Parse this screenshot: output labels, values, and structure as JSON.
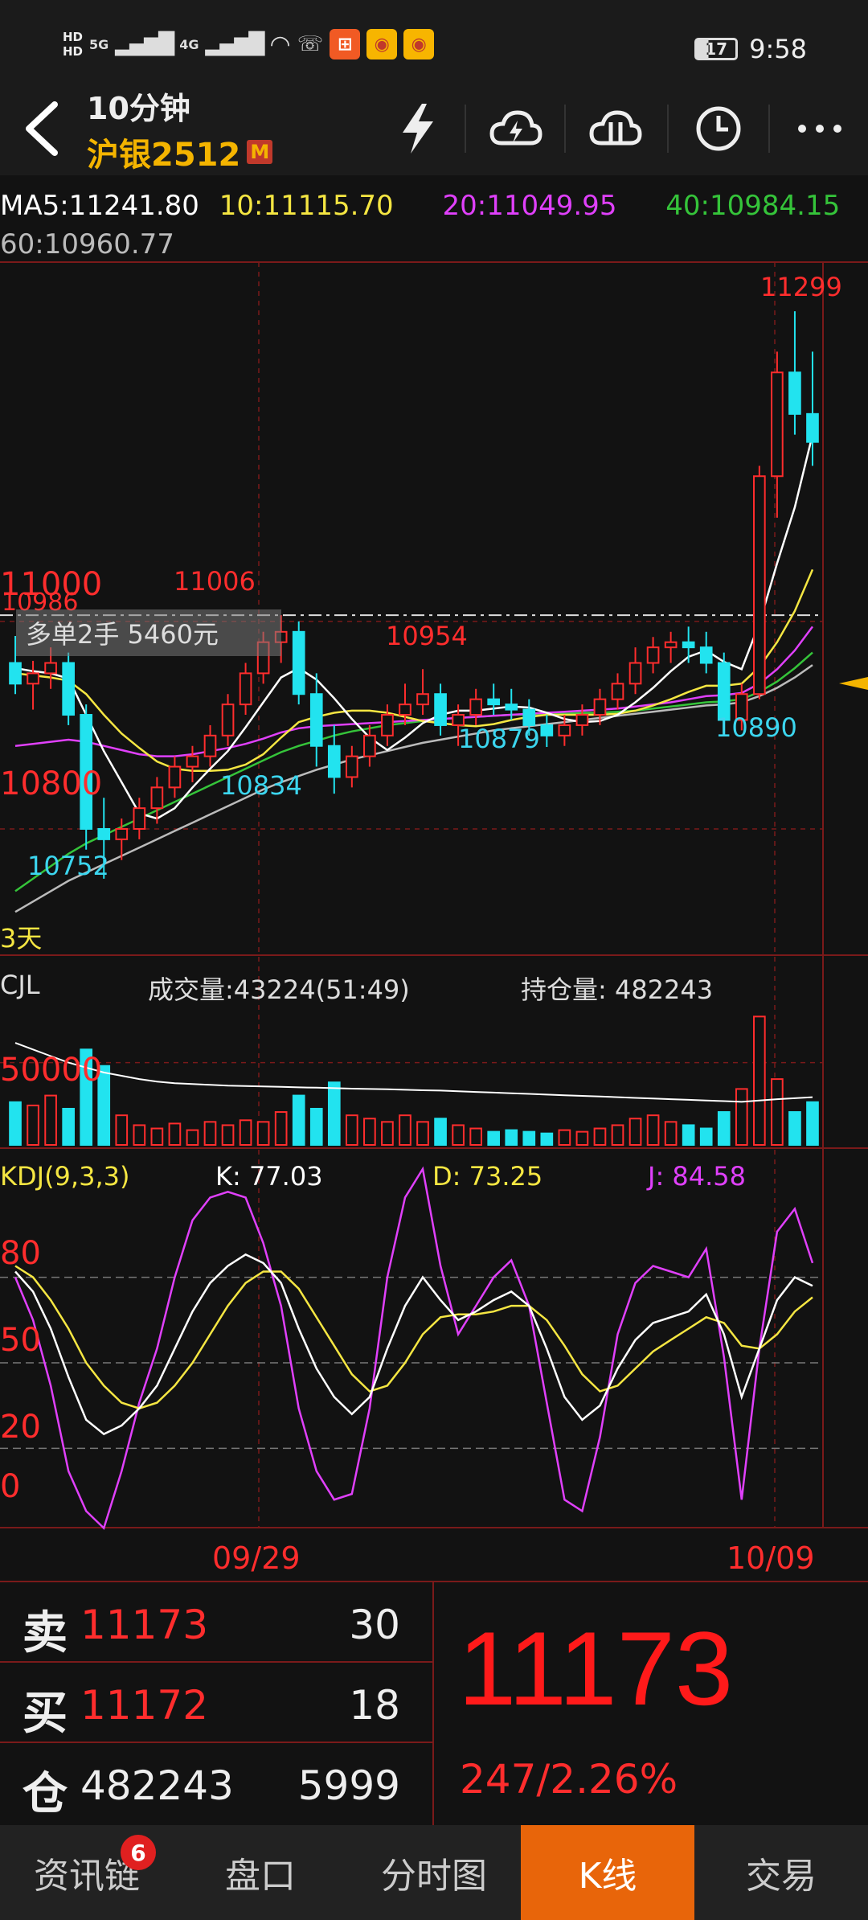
{
  "status": {
    "hd1": "HD",
    "hd2": "HD",
    "net1": "5G",
    "net2": "4G",
    "battery": "17",
    "time": "9:58"
  },
  "header": {
    "period": "10分钟",
    "symbol": "沪银2512",
    "badge": "M"
  },
  "ma": {
    "ma5": "MA5:11241.80",
    "ma10": "10:11115.70",
    "ma20": "20:11049.95",
    "ma40": "40:10984.15",
    "ma60": "60:10960.77"
  },
  "colors": {
    "up": "#ff2d2d",
    "down": "#22e3ef",
    "ma5": "#ffffff",
    "ma10": "#f5e642",
    "ma20": "#e040fb",
    "ma40": "#35c43a",
    "ma60": "#bbbbbb",
    "label_red": "#ff2d2d",
    "label_cyan": "#3cd6ef"
  },
  "main_panel": {
    "price_labels": [
      {
        "text": "11000",
        "price": 11000
      },
      {
        "text": "10800",
        "price": 10800
      }
    ],
    "high_label": "11299",
    "annotations_red": [
      "11006",
      "10954"
    ],
    "annotations_cyan": [
      "10752",
      "10834",
      "10879",
      "10890"
    ],
    "left_top_label": "10986",
    "position_tip": "多单2手  5460元",
    "days_label": "3天"
  },
  "volume_panel": {
    "title": "CJL",
    "volume": "成交量:43224(51:49)",
    "open_interest": "持仓量: 482243",
    "axis_label": "50000"
  },
  "kdj_panel": {
    "title": "KDJ(9,3,3)",
    "k": "K: 77.03",
    "d": "D: 73.25",
    "j": "J: 84.58",
    "levels": [
      "80",
      "50",
      "20",
      "0"
    ]
  },
  "dates": [
    "09/29",
    "10/09"
  ],
  "quote": {
    "sell_label": "卖",
    "sell_price": "11173",
    "sell_qty": "30",
    "buy_label": "买",
    "buy_price": "11172",
    "buy_qty": "18",
    "oi_label": "仓",
    "oi_value": "482243",
    "oi_change": "5999",
    "last_price": "11173",
    "change": "247/2.26%"
  },
  "tabs": [
    {
      "label": "资讯链",
      "badge": "6"
    },
    {
      "label": "盘口"
    },
    {
      "label": "分时图"
    },
    {
      "label": "K线",
      "active": true
    },
    {
      "label": "交易"
    }
  ],
  "chart_data": [
    {
      "type": "candlestick",
      "price_range": [
        10700,
        11320
      ],
      "candles": [
        [
          10960,
          10986,
          10930,
          10940
        ],
        [
          10940,
          10962,
          10915,
          10950
        ],
        [
          10950,
          10975,
          10935,
          10960
        ],
        [
          10960,
          10970,
          10900,
          10910
        ],
        [
          10910,
          10920,
          10780,
          10800
        ],
        [
          10800,
          10830,
          10752,
          10790
        ],
        [
          10790,
          10810,
          10770,
          10800
        ],
        [
          10800,
          10830,
          10790,
          10820
        ],
        [
          10820,
          10850,
          10805,
          10840
        ],
        [
          10840,
          10870,
          10830,
          10860
        ],
        [
          10860,
          10880,
          10845,
          10870
        ],
        [
          10870,
          10900,
          10860,
          10890
        ],
        [
          10890,
          10930,
          10880,
          10920
        ],
        [
          10920,
          10960,
          10910,
          10950
        ],
        [
          10950,
          10990,
          10940,
          10980
        ],
        [
          10980,
          11006,
          10960,
          10990
        ],
        [
          10990,
          11000,
          10920,
          10930
        ],
        [
          10930,
          10950,
          10860,
          10880
        ],
        [
          10880,
          10900,
          10834,
          10850
        ],
        [
          10850,
          10880,
          10840,
          10870
        ],
        [
          10870,
          10900,
          10860,
          10890
        ],
        [
          10890,
          10920,
          10880,
          10910
        ],
        [
          10910,
          10940,
          10900,
          10920
        ],
        [
          10920,
          10954,
          10910,
          10930
        ],
        [
          10930,
          10940,
          10890,
          10900
        ],
        [
          10900,
          10920,
          10880,
          10910
        ],
        [
          10910,
          10935,
          10900,
          10925
        ],
        [
          10925,
          10940,
          10910,
          10920
        ],
        [
          10920,
          10935,
          10905,
          10915
        ],
        [
          10915,
          10925,
          10890,
          10900
        ],
        [
          10900,
          10910,
          10879,
          10890
        ],
        [
          10890,
          10910,
          10880,
          10900
        ],
        [
          10900,
          10920,
          10890,
          10910
        ],
        [
          10910,
          10935,
          10900,
          10925
        ],
        [
          10925,
          10950,
          10915,
          10940
        ],
        [
          10940,
          10975,
          10930,
          10960
        ],
        [
          10960,
          10985,
          10950,
          10975
        ],
        [
          10975,
          10990,
          10960,
          10980
        ],
        [
          10980,
          10995,
          10960,
          10975
        ],
        [
          10975,
          10990,
          10950,
          10960
        ],
        [
          10960,
          10970,
          10890,
          10905
        ],
        [
          10905,
          10940,
          10895,
          10930
        ],
        [
          10930,
          11150,
          10925,
          11140
        ],
        [
          11140,
          11260,
          11100,
          11240
        ],
        [
          11240,
          11299,
          11180,
          11200
        ],
        [
          11200,
          11260,
          11150,
          11173
        ]
      ],
      "ma5": [
        10955,
        10952,
        10950,
        10945,
        10910,
        10875,
        10845,
        10815,
        10810,
        10820,
        10840,
        10858,
        10875,
        10898,
        10922,
        10946,
        10955,
        10944,
        10926,
        10906,
        10888,
        10876,
        10888,
        10902,
        10910,
        10914,
        10914,
        10916,
        10918,
        10917,
        10912,
        10906,
        10903,
        10904,
        10910,
        10922,
        10936,
        10952,
        10966,
        10972,
        10961,
        10954,
        10998,
        11056,
        11110,
        11180
      ],
      "ma10": [
        10950,
        10948,
        10946,
        10943,
        10930,
        10910,
        10892,
        10878,
        10865,
        10858,
        10856,
        10856,
        10857,
        10862,
        10872,
        10888,
        10903,
        10908,
        10912,
        10914,
        10914,
        10912,
        10908,
        10904,
        10902,
        10900,
        10899,
        10901,
        10905,
        10908,
        10910,
        10910,
        10910,
        10910,
        10911,
        10914,
        10919,
        10925,
        10932,
        10938,
        10938,
        10940,
        10956,
        10980,
        11010,
        11050
      ],
      "ma20": [
        10880,
        10882,
        10884,
        10886,
        10884,
        10880,
        10876,
        10872,
        10870,
        10870,
        10872,
        10875,
        10878,
        10882,
        10887,
        10893,
        10897,
        10899,
        10900,
        10901,
        10902,
        10903,
        10904,
        10905,
        10906,
        10907,
        10908,
        10909,
        10910,
        10911,
        10912,
        10913,
        10914,
        10915,
        10916,
        10918,
        10920,
        10922,
        10925,
        10928,
        10929,
        10931,
        10940,
        10954,
        10972,
        10995
      ],
      "ma40": [
        10740,
        10752,
        10764,
        10776,
        10786,
        10794,
        10802,
        10810,
        10818,
        10826,
        10834,
        10842,
        10850,
        10858,
        10866,
        10874,
        10880,
        10885,
        10890,
        10894,
        10897,
        10900,
        10902,
        10904,
        10906,
        10907,
        10908,
        10909,
        10910,
        10910,
        10911,
        10911,
        10912,
        10912,
        10913,
        10914,
        10916,
        10918,
        10920,
        10922,
        10923,
        10925,
        10932,
        10942,
        10955,
        10970
      ],
      "ma60": [
        10720,
        10730,
        10740,
        10750,
        10758,
        10766,
        10774,
        10782,
        10790,
        10798,
        10806,
        10814,
        10822,
        10830,
        10838,
        10845,
        10851,
        10857,
        10862,
        10867,
        10871,
        10875,
        10879,
        10883,
        10886,
        10889,
        10892,
        10895,
        10897,
        10899,
        10901,
        10903,
        10905,
        10907,
        10909,
        10911,
        10913,
        10915,
        10917,
        10919,
        10920,
        10922,
        10928,
        10936,
        10946,
        10958
      ]
    },
    {
      "type": "bar",
      "name": "CJL",
      "volume_range": [
        0,
        85000
      ],
      "volumes": [
        26000,
        24000,
        30000,
        22000,
        58000,
        48000,
        18000,
        12000,
        10000,
        13000,
        9000,
        14000,
        12000,
        15000,
        14000,
        20000,
        30000,
        22000,
        38000,
        18000,
        16000,
        14000,
        18000,
        14000,
        16000,
        12000,
        10000,
        8000,
        9000,
        8000,
        7000,
        9000,
        8000,
        10000,
        12000,
        16000,
        18000,
        14000,
        12000,
        10000,
        20000,
        34000,
        78000,
        40000,
        20000,
        26000
      ],
      "cjl_line": [
        62000,
        58000,
        54000,
        50000,
        47000,
        44000,
        42000,
        40000,
        38500,
        37500,
        37000,
        36500,
        36000,
        35800,
        35500,
        35300,
        35000,
        34800,
        34500,
        34200,
        34000,
        33800,
        33500,
        33200,
        33000,
        32600,
        32200,
        31800,
        31400,
        31000,
        30600,
        30200,
        29800,
        29400,
        29000,
        28600,
        28200,
        27800,
        27400,
        27000,
        26600,
        26200,
        27000,
        27800,
        28400,
        29000
      ]
    },
    {
      "type": "line",
      "name": "KDJ",
      "y_range": [
        -5,
        105
      ],
      "k": [
        82,
        75,
        62,
        45,
        30,
        25,
        28,
        34,
        42,
        55,
        68,
        78,
        84,
        88,
        85,
        78,
        62,
        48,
        38,
        32,
        38,
        55,
        70,
        80,
        72,
        65,
        68,
        72,
        75,
        70,
        55,
        38,
        30,
        35,
        48,
        58,
        64,
        66,
        68,
        74,
        60,
        38,
        55,
        72,
        80,
        77
      ],
      "d": [
        84,
        80,
        72,
        62,
        50,
        42,
        36,
        34,
        36,
        42,
        50,
        60,
        70,
        78,
        82,
        82,
        76,
        66,
        56,
        46,
        40,
        42,
        50,
        60,
        66,
        67,
        67,
        68,
        70,
        70,
        65,
        56,
        46,
        40,
        42,
        48,
        54,
        58,
        62,
        66,
        64,
        56,
        55,
        60,
        68,
        73
      ],
      "j": [
        80,
        65,
        42,
        12,
        -2,
        -8,
        12,
        36,
        55,
        80,
        100,
        108,
        110,
        108,
        92,
        70,
        34,
        12,
        2,
        4,
        34,
        80,
        108,
        118,
        84,
        60,
        70,
        80,
        86,
        70,
        36,
        2,
        -2,
        24,
        60,
        78,
        84,
        82,
        80,
        90,
        52,
        2,
        55,
        96,
        104,
        85
      ]
    }
  ]
}
